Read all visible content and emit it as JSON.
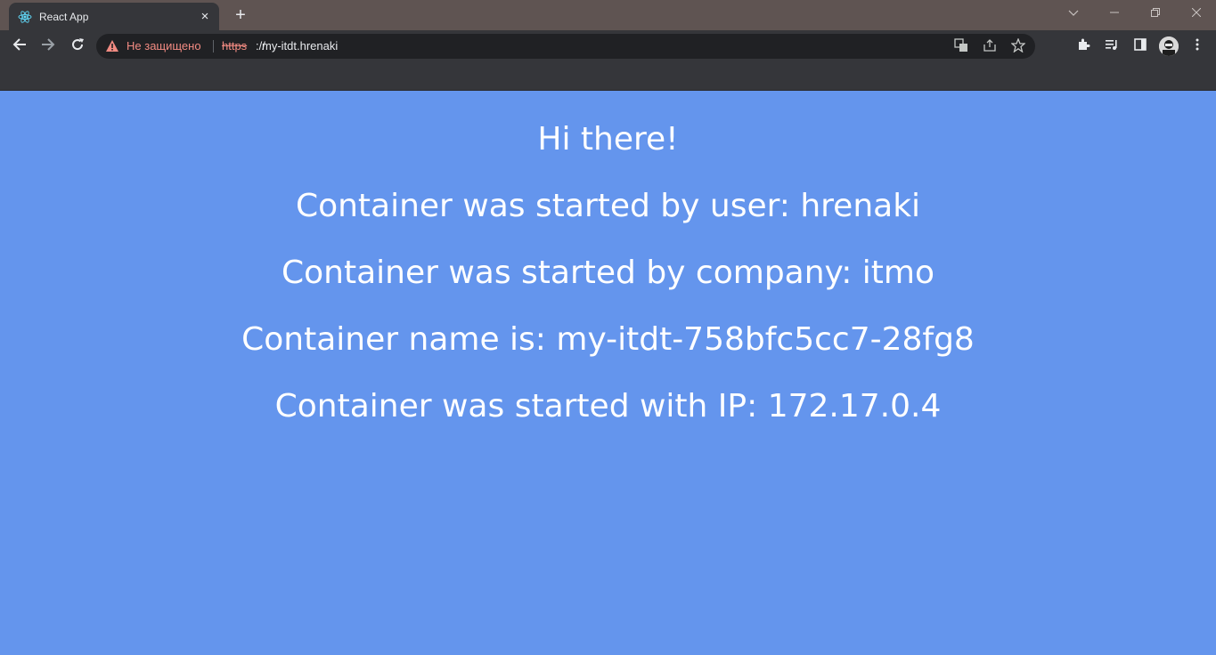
{
  "browser": {
    "tab_title": "React App",
    "tab_close": "×",
    "new_tab": "+",
    "insecure_label": "Не защищено",
    "url_scheme": "https",
    "url_slashes": "://",
    "url_host": "my-itdt.hrenaki"
  },
  "page": {
    "background_color": "#6495ed",
    "lines": [
      "Hi there!",
      "Container was started by user: hrenaki",
      "Container was started by company: itmo",
      "Container name is: my-itdt-758bfc5cc7-28fg8",
      "Container was started with IP: 172.17.0.4"
    ]
  }
}
